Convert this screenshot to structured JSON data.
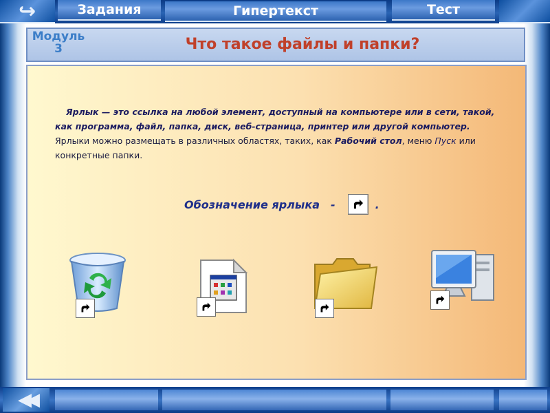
{
  "nav": {
    "tabs": [
      {
        "label": "Задания"
      },
      {
        "label": "Гипертекст"
      },
      {
        "label": "Тест"
      }
    ],
    "home_icon": "return-arrow-icon",
    "back_icon": "double-chevron-left-icon",
    "back_glyph": "◀◀"
  },
  "header": {
    "module": "Модуль 3",
    "title": "Что такое файлы и папки?"
  },
  "content": {
    "para_bold": "Ярлык — это ссылка на любой элемент, доступный на компьютере или в сети, такой, как программа, файл, папка, диск, веб-страница, принтер или другой компьютер.",
    "para_text1": " Ярлыки можно размещать в различных областях, таких, как ",
    "para_desk": "Рабочий стол",
    "para_text2": ", меню ",
    "para_start": "Пуск",
    "para_text3": " или конкретные папки.",
    "mark_label": "Обозначение ярлыка",
    "mark_dash": "-",
    "mark_dot": ".",
    "icons": [
      {
        "name": "recycle-bin-icon"
      },
      {
        "name": "program-document-icon"
      },
      {
        "name": "folder-icon"
      },
      {
        "name": "computer-icon"
      }
    ]
  },
  "colors": {
    "title": "#c0402a",
    "module": "#3c7ec8",
    "text": "#1b1b60",
    "frame": "#1c4f9c"
  }
}
